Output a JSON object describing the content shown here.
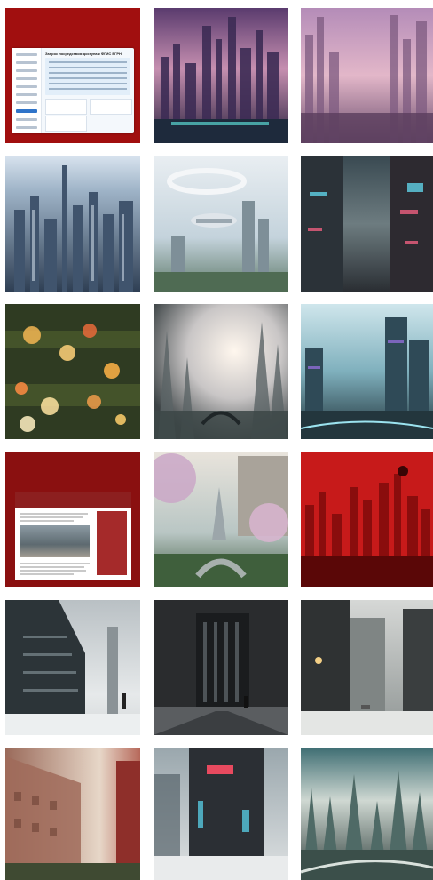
{
  "grid": {
    "tiles": [
      {
        "id": "t1",
        "kind": "screenshot",
        "title": "Запрос посредством доступа к ФГИС ЕГРН"
      },
      {
        "id": "t2",
        "kind": "image",
        "theme": "purple-futuristic-city"
      },
      {
        "id": "t3",
        "kind": "image",
        "theme": "pink-misty-city"
      },
      {
        "id": "t4",
        "kind": "image",
        "theme": "aerial-skyscrapers"
      },
      {
        "id": "t5",
        "kind": "image",
        "theme": "flying-vehicles-city"
      },
      {
        "id": "t6",
        "kind": "image",
        "theme": "cyberpunk-alley"
      },
      {
        "id": "t7",
        "kind": "image",
        "theme": "christmas-bokeh"
      },
      {
        "id": "t8",
        "kind": "image",
        "theme": "foggy-sunlit-city"
      },
      {
        "id": "t9",
        "kind": "image",
        "theme": "teal-futuristic-waterfront"
      },
      {
        "id": "t10",
        "kind": "screenshot",
        "theme": "news-website"
      },
      {
        "id": "t11",
        "kind": "image",
        "theme": "fantasy-garden-bridge"
      },
      {
        "id": "t12",
        "kind": "image",
        "theme": "red-city"
      },
      {
        "id": "t13",
        "kind": "image",
        "theme": "winter-glass-building"
      },
      {
        "id": "t14",
        "kind": "image",
        "theme": "dark-tower-snow"
      },
      {
        "id": "t15",
        "kind": "image",
        "theme": "winter-street"
      },
      {
        "id": "t16",
        "kind": "image",
        "theme": "misty-old-building"
      },
      {
        "id": "t17",
        "kind": "image",
        "theme": "neon-sign-building"
      },
      {
        "id": "t18",
        "kind": "image",
        "theme": "green-spires-river"
      }
    ]
  },
  "colors": {
    "background": "#ffffff",
    "accent_red": "#a10f0f"
  }
}
